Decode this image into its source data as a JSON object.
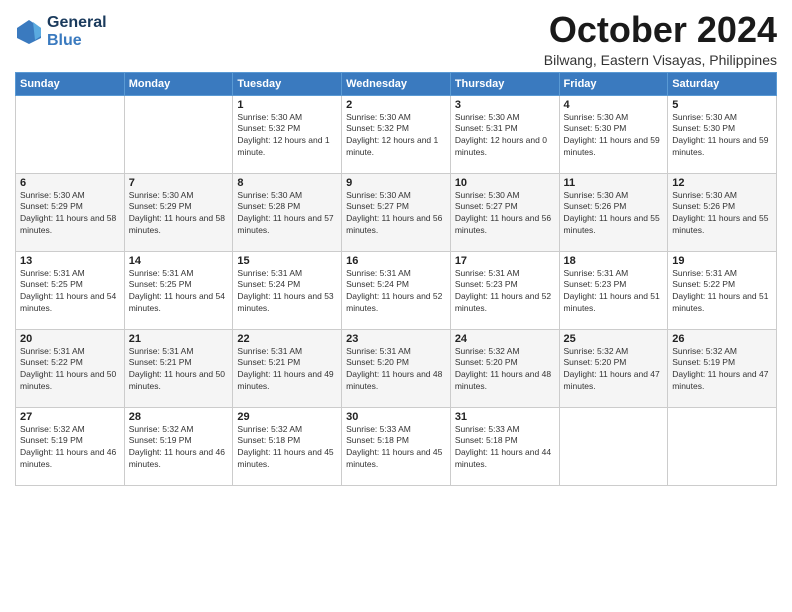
{
  "header": {
    "logo_line1": "General",
    "logo_line2": "Blue",
    "month": "October 2024",
    "location": "Bilwang, Eastern Visayas, Philippines"
  },
  "weekdays": [
    "Sunday",
    "Monday",
    "Tuesday",
    "Wednesday",
    "Thursday",
    "Friday",
    "Saturday"
  ],
  "weeks": [
    [
      {
        "day": "",
        "sunrise": "",
        "sunset": "",
        "daylight": ""
      },
      {
        "day": "",
        "sunrise": "",
        "sunset": "",
        "daylight": ""
      },
      {
        "day": "1",
        "sunrise": "Sunrise: 5:30 AM",
        "sunset": "Sunset: 5:32 PM",
        "daylight": "Daylight: 12 hours and 1 minute."
      },
      {
        "day": "2",
        "sunrise": "Sunrise: 5:30 AM",
        "sunset": "Sunset: 5:32 PM",
        "daylight": "Daylight: 12 hours and 1 minute."
      },
      {
        "day": "3",
        "sunrise": "Sunrise: 5:30 AM",
        "sunset": "Sunset: 5:31 PM",
        "daylight": "Daylight: 12 hours and 0 minutes."
      },
      {
        "day": "4",
        "sunrise": "Sunrise: 5:30 AM",
        "sunset": "Sunset: 5:30 PM",
        "daylight": "Daylight: 11 hours and 59 minutes."
      },
      {
        "day": "5",
        "sunrise": "Sunrise: 5:30 AM",
        "sunset": "Sunset: 5:30 PM",
        "daylight": "Daylight: 11 hours and 59 minutes."
      }
    ],
    [
      {
        "day": "6",
        "sunrise": "Sunrise: 5:30 AM",
        "sunset": "Sunset: 5:29 PM",
        "daylight": "Daylight: 11 hours and 58 minutes."
      },
      {
        "day": "7",
        "sunrise": "Sunrise: 5:30 AM",
        "sunset": "Sunset: 5:29 PM",
        "daylight": "Daylight: 11 hours and 58 minutes."
      },
      {
        "day": "8",
        "sunrise": "Sunrise: 5:30 AM",
        "sunset": "Sunset: 5:28 PM",
        "daylight": "Daylight: 11 hours and 57 minutes."
      },
      {
        "day": "9",
        "sunrise": "Sunrise: 5:30 AM",
        "sunset": "Sunset: 5:27 PM",
        "daylight": "Daylight: 11 hours and 56 minutes."
      },
      {
        "day": "10",
        "sunrise": "Sunrise: 5:30 AM",
        "sunset": "Sunset: 5:27 PM",
        "daylight": "Daylight: 11 hours and 56 minutes."
      },
      {
        "day": "11",
        "sunrise": "Sunrise: 5:30 AM",
        "sunset": "Sunset: 5:26 PM",
        "daylight": "Daylight: 11 hours and 55 minutes."
      },
      {
        "day": "12",
        "sunrise": "Sunrise: 5:30 AM",
        "sunset": "Sunset: 5:26 PM",
        "daylight": "Daylight: 11 hours and 55 minutes."
      }
    ],
    [
      {
        "day": "13",
        "sunrise": "Sunrise: 5:31 AM",
        "sunset": "Sunset: 5:25 PM",
        "daylight": "Daylight: 11 hours and 54 minutes."
      },
      {
        "day": "14",
        "sunrise": "Sunrise: 5:31 AM",
        "sunset": "Sunset: 5:25 PM",
        "daylight": "Daylight: 11 hours and 54 minutes."
      },
      {
        "day": "15",
        "sunrise": "Sunrise: 5:31 AM",
        "sunset": "Sunset: 5:24 PM",
        "daylight": "Daylight: 11 hours and 53 minutes."
      },
      {
        "day": "16",
        "sunrise": "Sunrise: 5:31 AM",
        "sunset": "Sunset: 5:24 PM",
        "daylight": "Daylight: 11 hours and 52 minutes."
      },
      {
        "day": "17",
        "sunrise": "Sunrise: 5:31 AM",
        "sunset": "Sunset: 5:23 PM",
        "daylight": "Daylight: 11 hours and 52 minutes."
      },
      {
        "day": "18",
        "sunrise": "Sunrise: 5:31 AM",
        "sunset": "Sunset: 5:23 PM",
        "daylight": "Daylight: 11 hours and 51 minutes."
      },
      {
        "day": "19",
        "sunrise": "Sunrise: 5:31 AM",
        "sunset": "Sunset: 5:22 PM",
        "daylight": "Daylight: 11 hours and 51 minutes."
      }
    ],
    [
      {
        "day": "20",
        "sunrise": "Sunrise: 5:31 AM",
        "sunset": "Sunset: 5:22 PM",
        "daylight": "Daylight: 11 hours and 50 minutes."
      },
      {
        "day": "21",
        "sunrise": "Sunrise: 5:31 AM",
        "sunset": "Sunset: 5:21 PM",
        "daylight": "Daylight: 11 hours and 50 minutes."
      },
      {
        "day": "22",
        "sunrise": "Sunrise: 5:31 AM",
        "sunset": "Sunset: 5:21 PM",
        "daylight": "Daylight: 11 hours and 49 minutes."
      },
      {
        "day": "23",
        "sunrise": "Sunrise: 5:31 AM",
        "sunset": "Sunset: 5:20 PM",
        "daylight": "Daylight: 11 hours and 48 minutes."
      },
      {
        "day": "24",
        "sunrise": "Sunrise: 5:32 AM",
        "sunset": "Sunset: 5:20 PM",
        "daylight": "Daylight: 11 hours and 48 minutes."
      },
      {
        "day": "25",
        "sunrise": "Sunrise: 5:32 AM",
        "sunset": "Sunset: 5:20 PM",
        "daylight": "Daylight: 11 hours and 47 minutes."
      },
      {
        "day": "26",
        "sunrise": "Sunrise: 5:32 AM",
        "sunset": "Sunset: 5:19 PM",
        "daylight": "Daylight: 11 hours and 47 minutes."
      }
    ],
    [
      {
        "day": "27",
        "sunrise": "Sunrise: 5:32 AM",
        "sunset": "Sunset: 5:19 PM",
        "daylight": "Daylight: 11 hours and 46 minutes."
      },
      {
        "day": "28",
        "sunrise": "Sunrise: 5:32 AM",
        "sunset": "Sunset: 5:19 PM",
        "daylight": "Daylight: 11 hours and 46 minutes."
      },
      {
        "day": "29",
        "sunrise": "Sunrise: 5:32 AM",
        "sunset": "Sunset: 5:18 PM",
        "daylight": "Daylight: 11 hours and 45 minutes."
      },
      {
        "day": "30",
        "sunrise": "Sunrise: 5:33 AM",
        "sunset": "Sunset: 5:18 PM",
        "daylight": "Daylight: 11 hours and 45 minutes."
      },
      {
        "day": "31",
        "sunrise": "Sunrise: 5:33 AM",
        "sunset": "Sunset: 5:18 PM",
        "daylight": "Daylight: 11 hours and 44 minutes."
      },
      {
        "day": "",
        "sunrise": "",
        "sunset": "",
        "daylight": ""
      },
      {
        "day": "",
        "sunrise": "",
        "sunset": "",
        "daylight": ""
      }
    ]
  ]
}
